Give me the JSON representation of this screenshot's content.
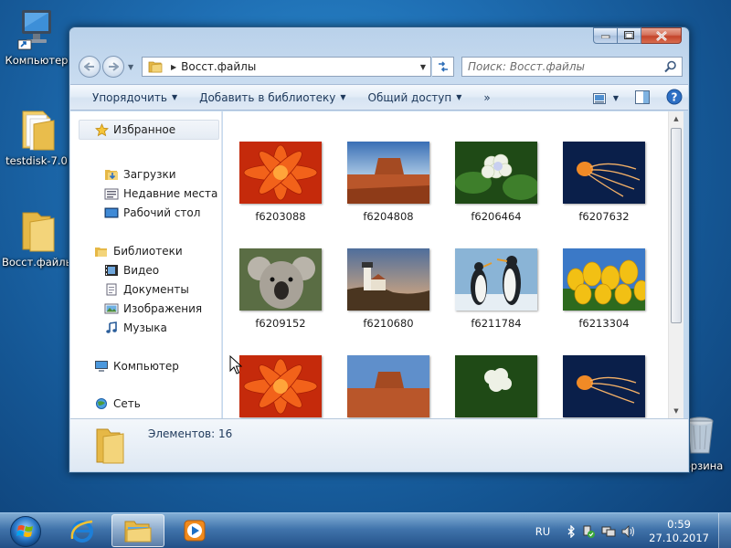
{
  "desktop": {
    "icons": [
      {
        "label": "Компьютер"
      },
      {
        "label": "testdisk-7.0"
      },
      {
        "label": "Восст.файлы"
      },
      {
        "label": "Корзина"
      }
    ]
  },
  "window": {
    "address": {
      "path": "Восст.файлы"
    },
    "search": {
      "placeholder": "Поиск: Восст.файлы"
    },
    "toolbar": {
      "organize": "Упорядочить",
      "add_to_library": "Добавить в библиотеку",
      "share": "Общий доступ",
      "more": "»"
    },
    "nav": {
      "favorites": "Избранное",
      "downloads": "Загрузки",
      "recent": "Недавние места",
      "desktop": "Рабочий стол",
      "libraries": "Библиотеки",
      "video": "Видео",
      "documents": "Документы",
      "images": "Изображения",
      "music": "Музыка",
      "computer": "Компьютер",
      "network": "Сеть"
    },
    "files": [
      {
        "name": "f6203088"
      },
      {
        "name": "f6204808"
      },
      {
        "name": "f6206464"
      },
      {
        "name": "f6207632"
      },
      {
        "name": "f6209152"
      },
      {
        "name": "f6210680"
      },
      {
        "name": "f6211784"
      },
      {
        "name": "f6213304"
      }
    ],
    "status": {
      "count_text": "Элементов: 16"
    }
  },
  "taskbar": {
    "lang": "RU",
    "time": "0:59",
    "date": "27.10.2017"
  }
}
